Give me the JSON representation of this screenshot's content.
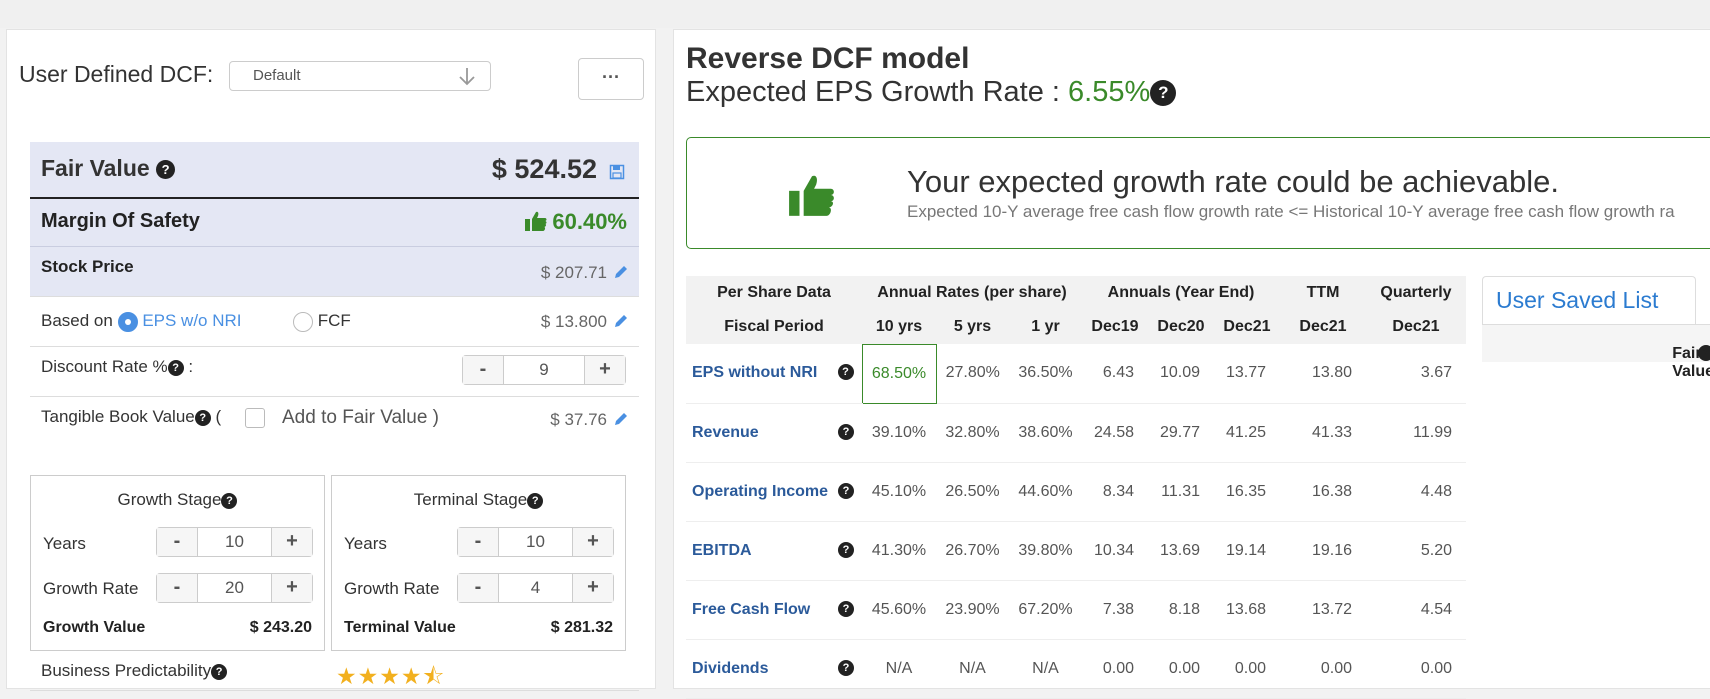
{
  "left_panel": {
    "udcf_label": "User Defined DCF:",
    "udcf_select_value": "Default",
    "more_label": "···",
    "fair_value_label": "Fair Value",
    "fair_value": "$ 524.52",
    "margin_label": "Margin Of Safety",
    "margin_value": "60.40%",
    "stock_price_label": "Stock Price",
    "stock_price_value": "$ 207.71",
    "based_on_label": "Based on",
    "option_eps": "EPS w/o NRI",
    "option_fcf": "FCF",
    "based_on_value": "$ 13.800",
    "discount_label": "Discount Rate %",
    "discount_colon": ":",
    "discount_value": "9",
    "tbv_label": "Tangible Book Value",
    "tbv_paren_open": "(",
    "add_to_fv_label": "Add to Fair Value )",
    "tbv_value": "$ 37.76",
    "minus": "-",
    "plus": "+",
    "growth_stage": {
      "title": "Growth Stage",
      "years_label": "Years",
      "years_value": "10",
      "rate_label": "Growth Rate",
      "rate_value": "20",
      "value_label": "Growth Value",
      "value": "$ 243.20"
    },
    "terminal_stage": {
      "title": "Terminal Stage",
      "years_label": "Years",
      "years_value": "10",
      "rate_label": "Growth Rate",
      "rate_value": "4",
      "value_label": "Terminal Value",
      "value": "$ 281.32"
    },
    "predictability_label": "Business Predictability",
    "predictability_stars": 4.5,
    "stars_text": "★★★★⯪"
  },
  "right_panel": {
    "title": "Reverse DCF model",
    "subtitle_prefix": "Expected EPS Growth Rate :",
    "subtitle_value": "6.55%",
    "achieve_head": "Your expected growth rate could be achievable.",
    "achieve_desc": "Expected 10-Y average free cash flow growth rate <= Historical 10-Y average free cash flow growth ra",
    "table": {
      "group_headers": [
        "Per Share Data",
        "Annual Rates (per share)",
        "Annuals (Year End)",
        "TTM",
        "Quarterly"
      ],
      "sub_headers": [
        "Fiscal Period",
        "10 yrs",
        "5 yrs",
        "1 yr",
        "Dec19",
        "Dec20",
        "Dec21",
        "Dec21",
        "Dec21"
      ],
      "rows": [
        {
          "name": "EPS without NRI",
          "values": [
            "68.50%",
            "27.80%",
            "36.50%",
            "6.43",
            "10.09",
            "13.77",
            "13.80",
            "3.67"
          ]
        },
        {
          "name": "Revenue",
          "values": [
            "39.10%",
            "32.80%",
            "38.60%",
            "24.58",
            "29.77",
            "41.25",
            "41.33",
            "11.99"
          ]
        },
        {
          "name": "Operating Income",
          "values": [
            "45.10%",
            "26.50%",
            "44.60%",
            "8.34",
            "11.31",
            "16.35",
            "16.38",
            "4.48"
          ]
        },
        {
          "name": "EBITDA",
          "values": [
            "41.30%",
            "26.70%",
            "39.80%",
            "10.34",
            "13.69",
            "19.14",
            "19.16",
            "5.20"
          ]
        },
        {
          "name": "Free Cash Flow",
          "values": [
            "45.60%",
            "23.90%",
            "67.20%",
            "7.38",
            "8.18",
            "13.68",
            "13.72",
            "4.54"
          ]
        },
        {
          "name": "Dividends",
          "values": [
            "N/A",
            "N/A",
            "N/A",
            "0.00",
            "0.00",
            "0.00",
            "0.00",
            "0.00"
          ]
        }
      ]
    },
    "saved_list_tab": "User Saved List",
    "saved_list_col": "Fair Value"
  },
  "colors": {
    "accent_green": "#3a8a2a",
    "accent_blue": "#4a90e2",
    "link_blue": "#2b5a9a",
    "panel_lavender": "#e4e7f4",
    "star": "#f2b01e"
  },
  "icons": [
    "chevron-down-icon",
    "question-icon",
    "save-icon",
    "thumbs-up-icon",
    "pencil-icon",
    "star-icon"
  ]
}
